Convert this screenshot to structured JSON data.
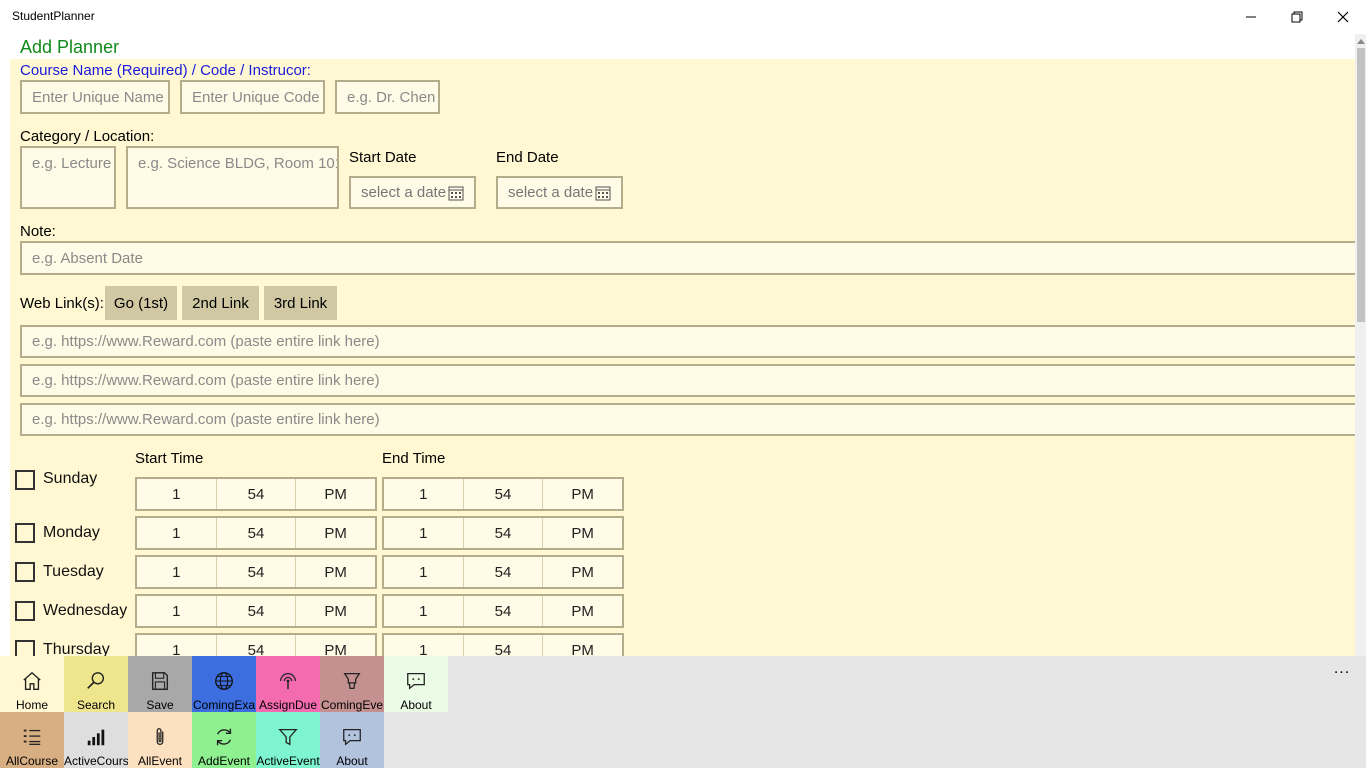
{
  "window": {
    "title": "StudentPlanner"
  },
  "page": {
    "title": "Add Planner"
  },
  "course": {
    "label": "Course Name (Required) / Code / Instrucor:",
    "name_placeholder": "Enter Unique Name",
    "code_placeholder": "Enter Unique Code",
    "instructor_placeholder": "e.g. Dr. Chen"
  },
  "category": {
    "label": "Category / Location:",
    "category_placeholder": "e.g. Lecture",
    "location_placeholder": "e.g. Science BLDG, Room 101"
  },
  "dates": {
    "start_label": "Start Date",
    "end_label": "End Date",
    "start_placeholder": "select a date",
    "end_placeholder": "select a date"
  },
  "note": {
    "label": "Note:",
    "placeholder": "e.g. Absent Date"
  },
  "weblinks": {
    "label": "Web Link(s):",
    "buttons": [
      "Go (1st)",
      "2nd Link",
      "3rd Link"
    ],
    "placeholders": [
      "e.g. https://www.Reward.com (paste entire link here)",
      "e.g. https://www.Reward.com (paste entire link here)",
      "e.g. https://www.Reward.com (paste entire link here)"
    ]
  },
  "schedule": {
    "start_label": "Start Time",
    "end_label": "End Time",
    "days": [
      {
        "name": "Sunday",
        "start": [
          "1",
          "54",
          "PM"
        ],
        "end": [
          "1",
          "54",
          "PM"
        ]
      },
      {
        "name": "Monday",
        "start": [
          "1",
          "54",
          "PM"
        ],
        "end": [
          "1",
          "54",
          "PM"
        ]
      },
      {
        "name": "Tuesday",
        "start": [
          "1",
          "54",
          "PM"
        ],
        "end": [
          "1",
          "54",
          "PM"
        ]
      },
      {
        "name": "Wednesday",
        "start": [
          "1",
          "54",
          "PM"
        ],
        "end": [
          "1",
          "54",
          "PM"
        ]
      },
      {
        "name": "Thursday",
        "start": [
          "1",
          "54",
          "PM"
        ],
        "end": [
          "1",
          "54",
          "PM"
        ]
      }
    ]
  },
  "commandbar": {
    "row1": [
      {
        "label": "Home",
        "icon": "home-icon",
        "color": "#fff8d2"
      },
      {
        "label": "Search",
        "icon": "search-icon",
        "color": "#efe58d"
      },
      {
        "label": "Save",
        "icon": "save-icon",
        "color": "#a8a8a8"
      },
      {
        "label": "ComingExa",
        "icon": "globe-icon",
        "color": "#3d6ee0"
      },
      {
        "label": "AssignDue",
        "icon": "touch-icon",
        "color": "#f56bb0"
      },
      {
        "label": "ComingEve",
        "icon": "highlighter-icon",
        "color": "#c49090"
      },
      {
        "label": "About",
        "icon": "message-icon",
        "color": "#eafbe6"
      }
    ],
    "row2": [
      {
        "label": "AllCourse",
        "icon": "list-icon",
        "color": "#d8ae83"
      },
      {
        "label": "ActiveCours",
        "icon": "signal-icon",
        "color": "#dedede"
      },
      {
        "label": "AllEvent",
        "icon": "paperclip-icon",
        "color": "#fde0c0"
      },
      {
        "label": "AddEvent",
        "icon": "refresh-icon",
        "color": "#8ef08e"
      },
      {
        "label": "ActiveEvent",
        "icon": "filter-icon",
        "color": "#7ff5cf"
      },
      {
        "label": "About",
        "icon": "message-icon",
        "color": "#b1c3dd"
      }
    ],
    "more": "..."
  }
}
